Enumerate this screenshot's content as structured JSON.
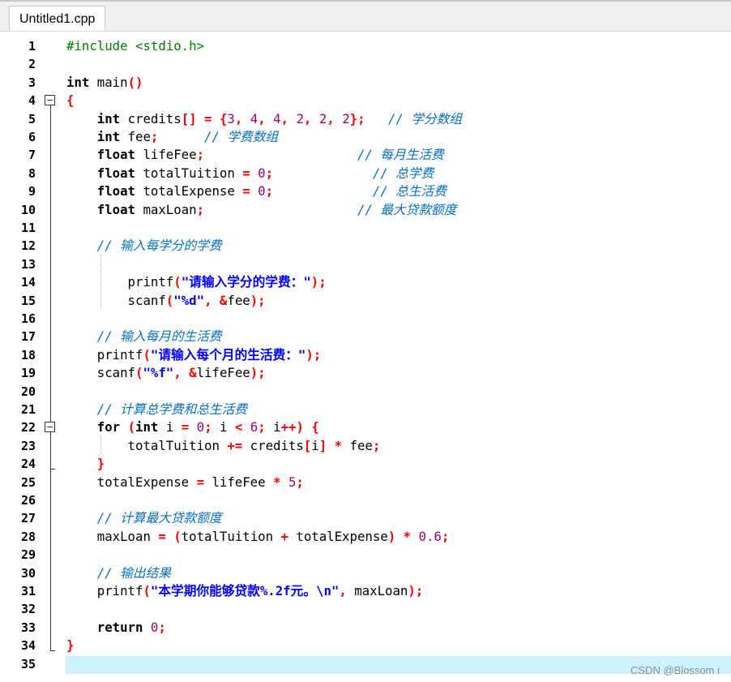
{
  "tab": {
    "title": "Untitled1.cpp"
  },
  "gutter": {
    "line_numbers": [
      "1",
      "2",
      "3",
      "4",
      "5",
      "6",
      "7",
      "8",
      "9",
      "10",
      "11",
      "12",
      "13",
      "14",
      "15",
      "16",
      "17",
      "18",
      "19",
      "20",
      "21",
      "22",
      "23",
      "24",
      "25",
      "26",
      "27",
      "28",
      "29",
      "30",
      "31",
      "32",
      "33",
      "34",
      "35"
    ]
  },
  "code": {
    "l1": [
      "#include <stdio.h>"
    ],
    "l3": [
      "int",
      " main",
      "()"
    ],
    "l4": [
      "{"
    ],
    "l5": [
      "    ",
      "int",
      " credits",
      "[]",
      " ",
      "=",
      " ",
      "{",
      "3",
      ",",
      " ",
      "4",
      ",",
      " ",
      "4",
      ",",
      " ",
      "2",
      ",",
      " ",
      "2",
      ",",
      " ",
      "2",
      "};",
      "   ",
      "// 学分数组"
    ],
    "l6": [
      "    ",
      "int",
      " fee",
      ";",
      "      ",
      "// 学费数组"
    ],
    "l7": [
      "    ",
      "float",
      " lifeFee",
      ";",
      "                    ",
      "// 每月生活费"
    ],
    "l8": [
      "    ",
      "float",
      " totalTuition ",
      "=",
      " ",
      "0",
      ";",
      "             ",
      "// 总学费"
    ],
    "l9": [
      "    ",
      "float",
      " totalExpense ",
      "=",
      " ",
      "0",
      ";",
      "             ",
      "// 总生活费"
    ],
    "l10": [
      "    ",
      "float",
      " maxLoan",
      ";",
      "                    ",
      "// 最大贷款额度"
    ],
    "l12": [
      "    ",
      "// 输入每学分的学费"
    ],
    "l14": [
      "        printf",
      "(",
      "\"请输入学分的学费：\"",
      ");"
    ],
    "l15": [
      "        scanf",
      "(",
      "\"%d\"",
      ",",
      " ",
      "&",
      "fee",
      ");"
    ],
    "l17": [
      "    ",
      "// 输入每月的生活费"
    ],
    "l18": [
      "    printf",
      "(",
      "\"请输入每个月的生活费：\"",
      ");"
    ],
    "l19": [
      "    scanf",
      "(",
      "\"%f\"",
      ",",
      " ",
      "&",
      "lifeFee",
      ");"
    ],
    "l21": [
      "    ",
      "// 计算总学费和总生活费"
    ],
    "l22": [
      "    ",
      "for",
      " ",
      "(",
      "int",
      " i ",
      "=",
      " ",
      "0",
      ";",
      " i ",
      "<",
      " ",
      "6",
      ";",
      " i",
      "++",
      ")",
      " ",
      "{"
    ],
    "l23": [
      "        totalTuition ",
      "+=",
      " credits",
      "[",
      "i",
      "]",
      " ",
      "*",
      " fee",
      ";"
    ],
    "l24": [
      "    ",
      "}"
    ],
    "l25": [
      "    totalExpense ",
      "=",
      " lifeFee ",
      "*",
      " ",
      "5",
      ";"
    ],
    "l27": [
      "    ",
      "// 计算最大贷款额度"
    ],
    "l28": [
      "    maxLoan ",
      "=",
      " ",
      "(",
      "totalTuition ",
      "+",
      " totalExpense",
      ")",
      " ",
      "*",
      " ",
      "0.6",
      ";"
    ],
    "l30": [
      "    ",
      "// 输出结果"
    ],
    "l31": [
      "    printf",
      "(",
      "\"本学期你能够贷款%.2f元。\\n\"",
      ",",
      " maxLoan",
      ");"
    ],
    "l33": [
      "    ",
      "return",
      " ",
      "0",
      ";"
    ],
    "l34": [
      "}"
    ]
  },
  "watermark": "CSDN @Blossom i",
  "colors": {
    "keyword": "#000000",
    "preprocessor": "#008000",
    "number": "#a0006e",
    "symbol": "#ff0000",
    "string": "#0000ff",
    "comment": "#0070c0",
    "current_line": "#ccf4ff"
  }
}
